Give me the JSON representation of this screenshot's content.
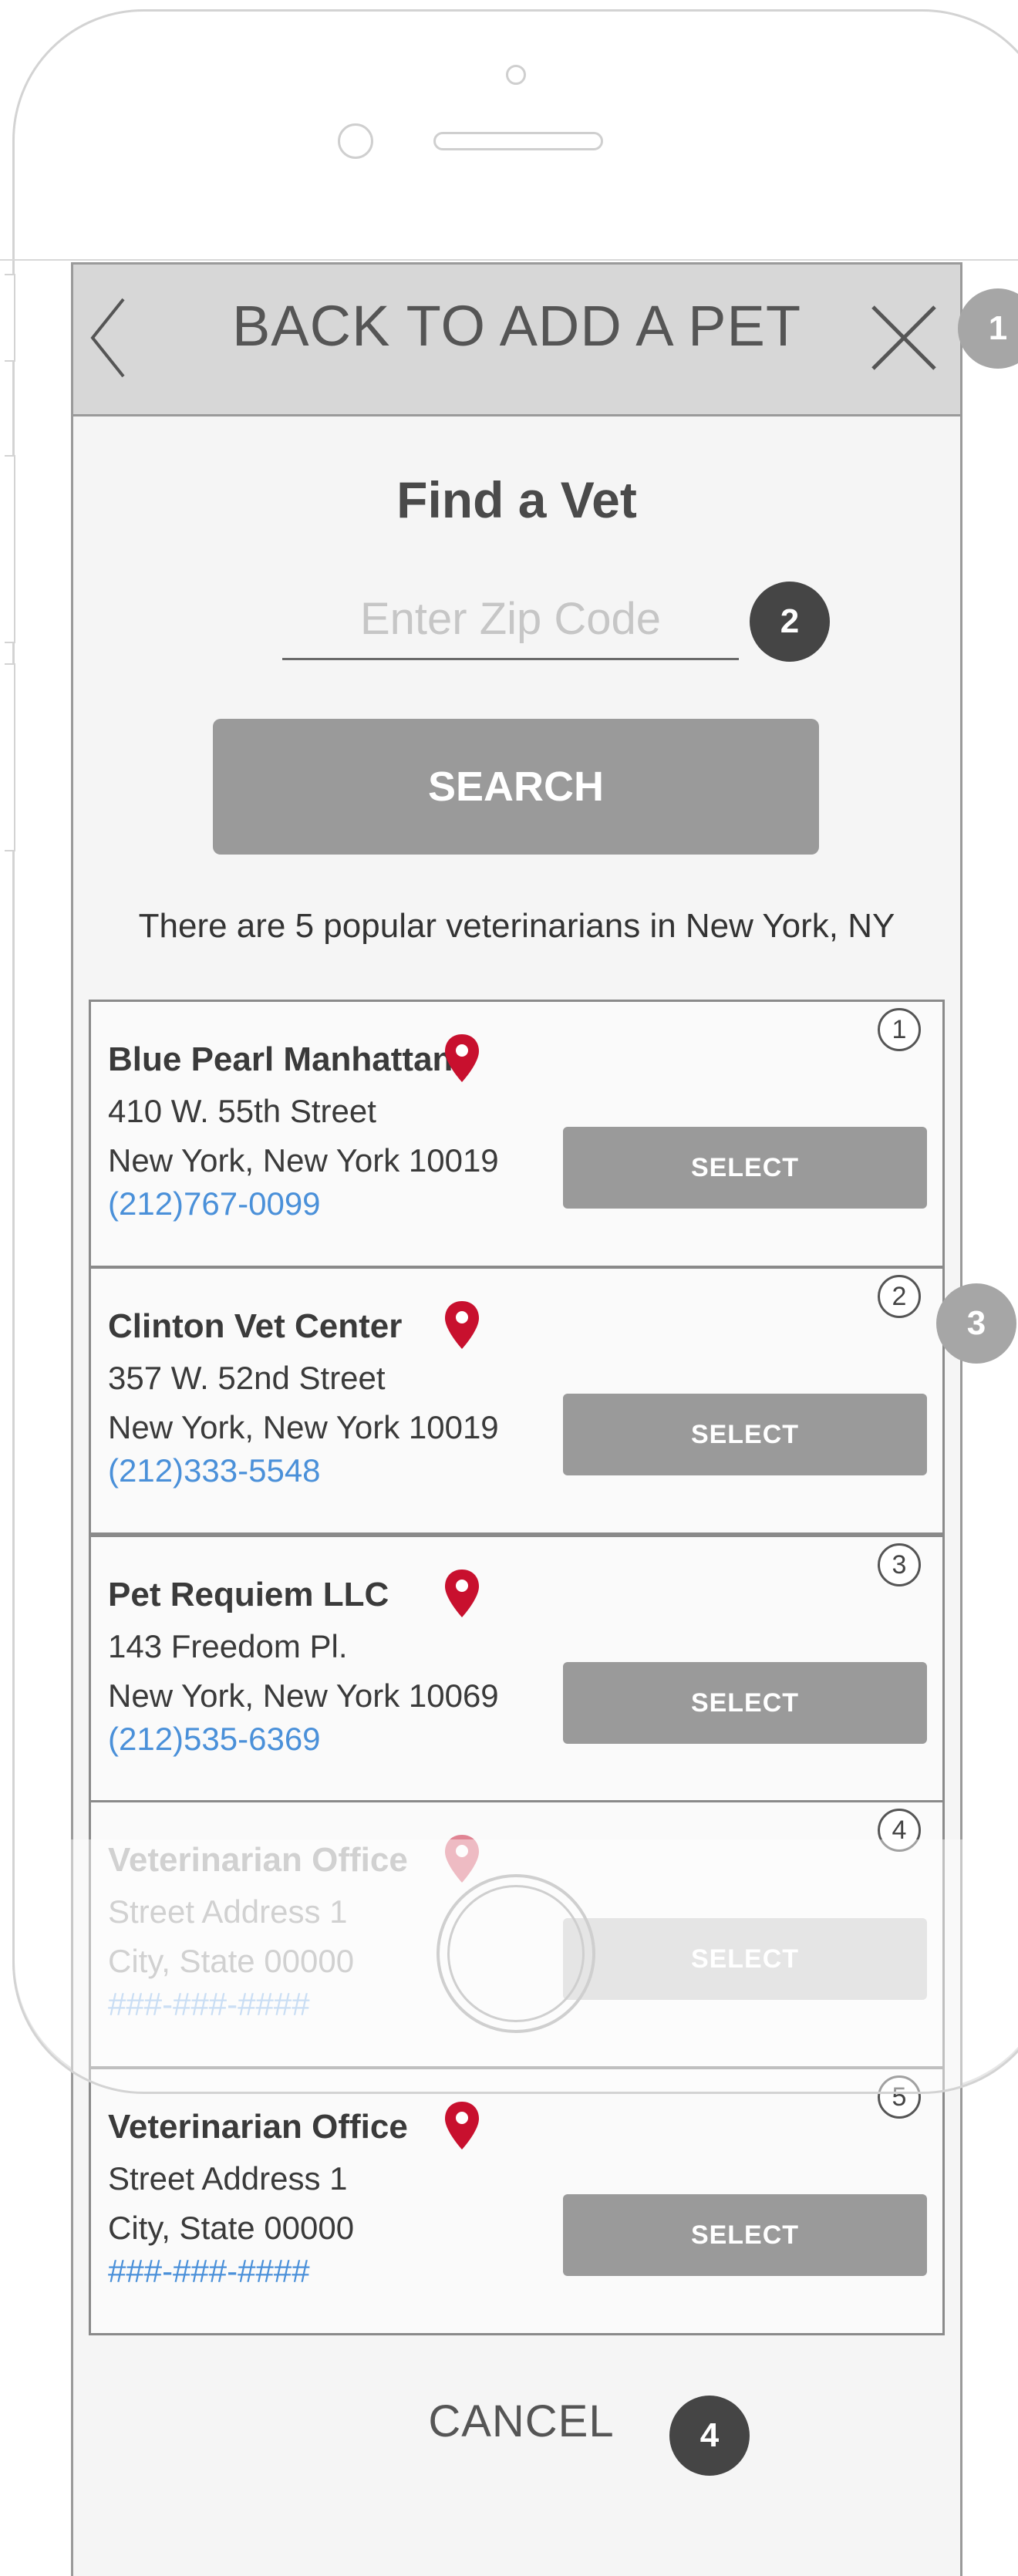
{
  "header": {
    "title": "BACK TO ADD A PET",
    "back_icon": "chevron-left-icon",
    "close_icon": "close-icon"
  },
  "annotations": {
    "a1": "1",
    "a2": "2",
    "a3": "3",
    "a4": "4"
  },
  "page": {
    "title": "Find a Vet",
    "zip_placeholder": "Enter Zip Code",
    "zip_value": "",
    "search_label": "SEARCH",
    "results_text": "There are 5 popular veterinarians in New York, NY"
  },
  "vets": [
    {
      "number": "1",
      "name": "Blue Pearl Manhattan",
      "address": "410 W. 55th Street",
      "city": "New York, New York 10019",
      "phone": "(212)767-0099",
      "select_label": "SELECT"
    },
    {
      "number": "2",
      "name": "Clinton Vet Center",
      "address": "357 W. 52nd Street",
      "city": "New York, New York 10019",
      "phone": "(212)333-5548",
      "select_label": "SELECT"
    },
    {
      "number": "3",
      "name": "Pet Requiem LLC",
      "address": "143 Freedom Pl.",
      "city": "New York, New York 10069",
      "phone": "(212)535-6369",
      "select_label": "SELECT"
    },
    {
      "number": "4",
      "name": "Veterinarian Office",
      "address": "Street Address 1",
      "city": "City, State 00000",
      "phone": "###-###-####",
      "select_label": "SELECT"
    },
    {
      "number": "5",
      "name": "Veterinarian Office",
      "address": "Street Address 1",
      "city": "City, State 00000",
      "phone": "###-###-####",
      "select_label": "SELECT"
    }
  ],
  "cancel_label": "CANCEL",
  "colors": {
    "pin": "#c8102e",
    "link": "#4a90d9",
    "button": "#9a9a9a",
    "header_bg": "#d7d7d7"
  }
}
